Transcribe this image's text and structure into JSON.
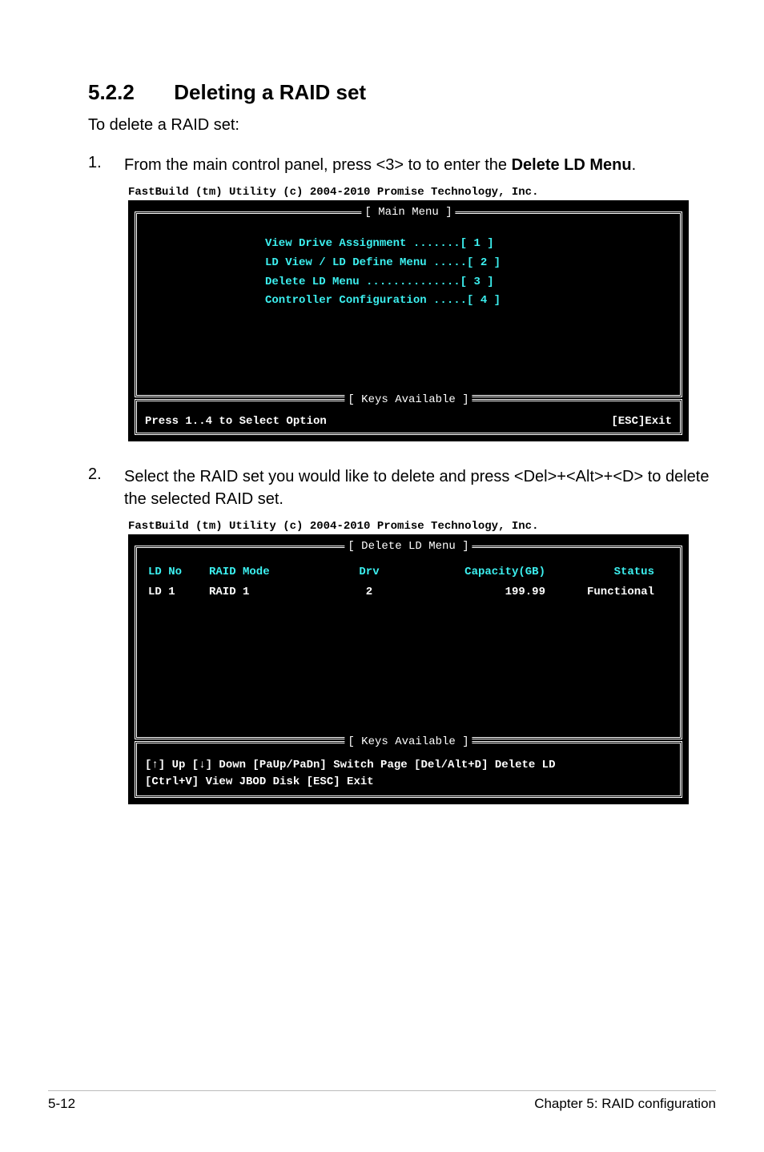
{
  "heading": {
    "number": "5.2.2",
    "title": "Deleting a RAID set"
  },
  "intro": "To delete a RAID set:",
  "steps": {
    "s1_num": "1.",
    "s1_pre": "From the main control panel, press <3> to to enter the ",
    "s1_bold": "Delete LD Menu",
    "s1_post": ".",
    "s2_num": "2.",
    "s2_text": "Select the RAID set you would like to delete and press <Del>+<Alt>+<D> to delete the selected RAID set."
  },
  "term_header": "FastBuild (tm) Utility (c) 2004-2010 Promise Technology, Inc.",
  "mainmenu": {
    "title": "[ Main Menu ]",
    "l1": "View Drive Assignment .......[ 1 ]",
    "l2": "LD View / LD Define Menu .....[ 2 ]",
    "l3": "Delete LD Menu ..............[ 3 ]",
    "l4": "Controller Configuration .....[ 4 ]"
  },
  "keys_title": "[ Keys Available ]",
  "mainfoot": {
    "left": "Press 1..4 to Select Option",
    "right": "[ESC]Exit"
  },
  "deletemenu": {
    "title": "[ Delete LD Menu ]",
    "head": {
      "ld": "LD No",
      "mode": "RAID Mode",
      "drv": "Drv",
      "cap": "Capacity(GB)",
      "stat": "Status"
    },
    "row": {
      "ld": "LD  1",
      "mode": "RAID 1",
      "drv": "2",
      "cap": "199.99",
      "stat": "Functional"
    }
  },
  "deletefoot": {
    "line1": "[↑] Up [↓] Down [PaUp/PaDn] Switch Page [Del/Alt+D] Delete LD",
    "line2": "[Ctrl+V] View JBOD Disk  [ESC] Exit"
  },
  "footer": {
    "left": "5-12",
    "right": "Chapter 5: RAID configuration"
  }
}
